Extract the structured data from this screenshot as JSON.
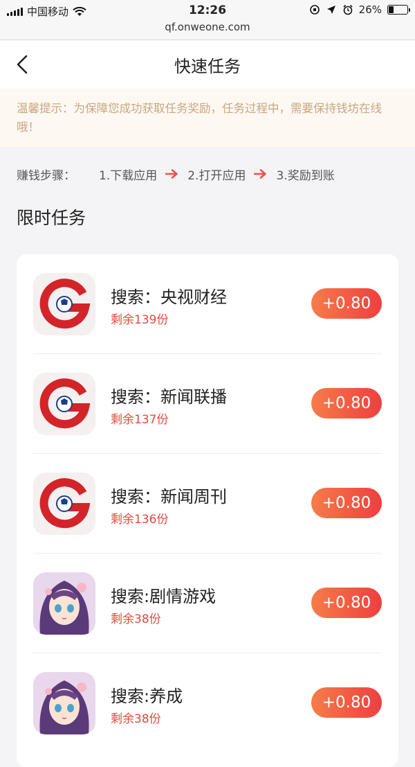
{
  "status": {
    "carrier": "中国移动",
    "time": "12:26",
    "url": "qf.onweone.com",
    "battery": "26%",
    "battery_level": 0.26
  },
  "nav": {
    "title": "快速任务",
    "back_icon": "chevron-left-icon"
  },
  "tip": {
    "text": "温馨提示：为保障您成功获取任务奖励，任务过程中，需要保持钱坊在线哦！"
  },
  "steps": {
    "label": "赚钱步骤：",
    "items": [
      "1.下载应用",
      "2.打开应用",
      "3.奖励到账"
    ],
    "arrow_color": "#f0504a"
  },
  "section": {
    "title": "限时任务"
  },
  "tasks": [
    {
      "name": "搜索：央视财经",
      "remaining": "剩余139份",
      "reward": "+0.80",
      "icon": "cctv-finance-logo-icon"
    },
    {
      "name": "搜索：新闻联播",
      "remaining": "剩余137份",
      "reward": "+0.80",
      "icon": "cctv-finance-logo-icon"
    },
    {
      "name": "搜索：新闻周刊",
      "remaining": "剩余136份",
      "reward": "+0.80",
      "icon": "cctv-finance-logo-icon"
    },
    {
      "name": "搜索:剧情游戏",
      "remaining": "剩余38份",
      "reward": "+0.80",
      "icon": "anime-girl-game-icon"
    },
    {
      "name": "搜索:养成",
      "remaining": "剩余38份",
      "reward": "+0.80",
      "icon": "anime-girl-game-icon"
    }
  ],
  "colors": {
    "accent": "#ee3f3f",
    "remaining_text": "#e24a3a",
    "tip_text": "#c7a784"
  }
}
